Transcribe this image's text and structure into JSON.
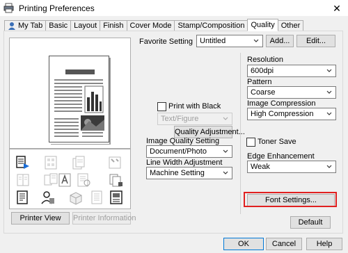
{
  "window": {
    "title": "Printing Preferences",
    "close_glyph": "✕"
  },
  "tabs": [
    {
      "label": "My Tab",
      "active": false
    },
    {
      "label": "Basic",
      "active": false
    },
    {
      "label": "Layout",
      "active": false
    },
    {
      "label": "Finish",
      "active": false
    },
    {
      "label": "Cover Mode",
      "active": false
    },
    {
      "label": "Stamp/Composition",
      "active": false
    },
    {
      "label": "Quality",
      "active": true
    },
    {
      "label": "Other",
      "active": false
    }
  ],
  "favorite": {
    "label": "Favorite Setting",
    "value": "Untitled",
    "add_label": "Add...",
    "edit_label": "Edit..."
  },
  "print_with_black": {
    "label": "Print with Black",
    "checked": false,
    "select_value": "Text/Figure"
  },
  "quality_adjustment_label": "Quality Adjustment...",
  "image_quality": {
    "label": "Image Quality Setting",
    "value": "Document/Photo"
  },
  "line_width": {
    "label": "Line Width Adjustment",
    "value": "Machine Setting"
  },
  "resolution": {
    "label": "Resolution",
    "value": "600dpi"
  },
  "pattern": {
    "label": "Pattern",
    "value": "Coarse"
  },
  "image_compression": {
    "label": "Image Compression",
    "value": "High Compression"
  },
  "toner_save": {
    "label": "Toner Save",
    "checked": false
  },
  "edge_enhancement": {
    "label": "Edge Enhancement",
    "value": "Weak"
  },
  "font_settings_label": "Font Settings...",
  "printer_view_label": "Printer View",
  "printer_information_label": "Printer Information",
  "default_label": "Default",
  "footer": {
    "ok": "OK",
    "cancel": "Cancel",
    "help": "Help"
  },
  "colors": {
    "highlight": "#e02020",
    "focus": "#0078d7"
  }
}
